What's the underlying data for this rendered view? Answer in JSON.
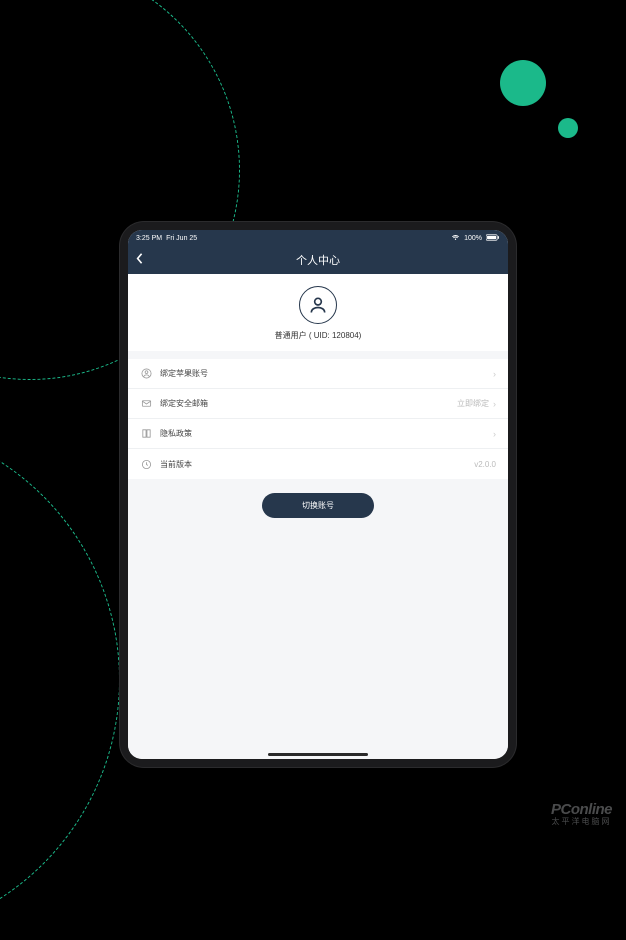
{
  "status_bar": {
    "time": "3:25 PM",
    "date": "Fri Jun 25",
    "wifi": "wifi",
    "battery": "100%"
  },
  "header": {
    "title": "个人中心"
  },
  "profile": {
    "user_label": "普通用户 ( UID: 120804)"
  },
  "list": {
    "items": [
      {
        "label": "绑定苹果账号",
        "tail": "",
        "icon": "user-icon"
      },
      {
        "label": "绑定安全邮箱",
        "tail": "立即绑定",
        "icon": "mail-icon"
      },
      {
        "label": "隐私政策",
        "tail": "",
        "icon": "book-icon"
      },
      {
        "label": "当前版本",
        "tail": "v2.0.0",
        "icon": "clock-icon",
        "no_chevron": true
      }
    ]
  },
  "actions": {
    "switch_account": "切换账号"
  },
  "watermark": {
    "logo": "PConline",
    "sub": "太平洋电脑网"
  }
}
